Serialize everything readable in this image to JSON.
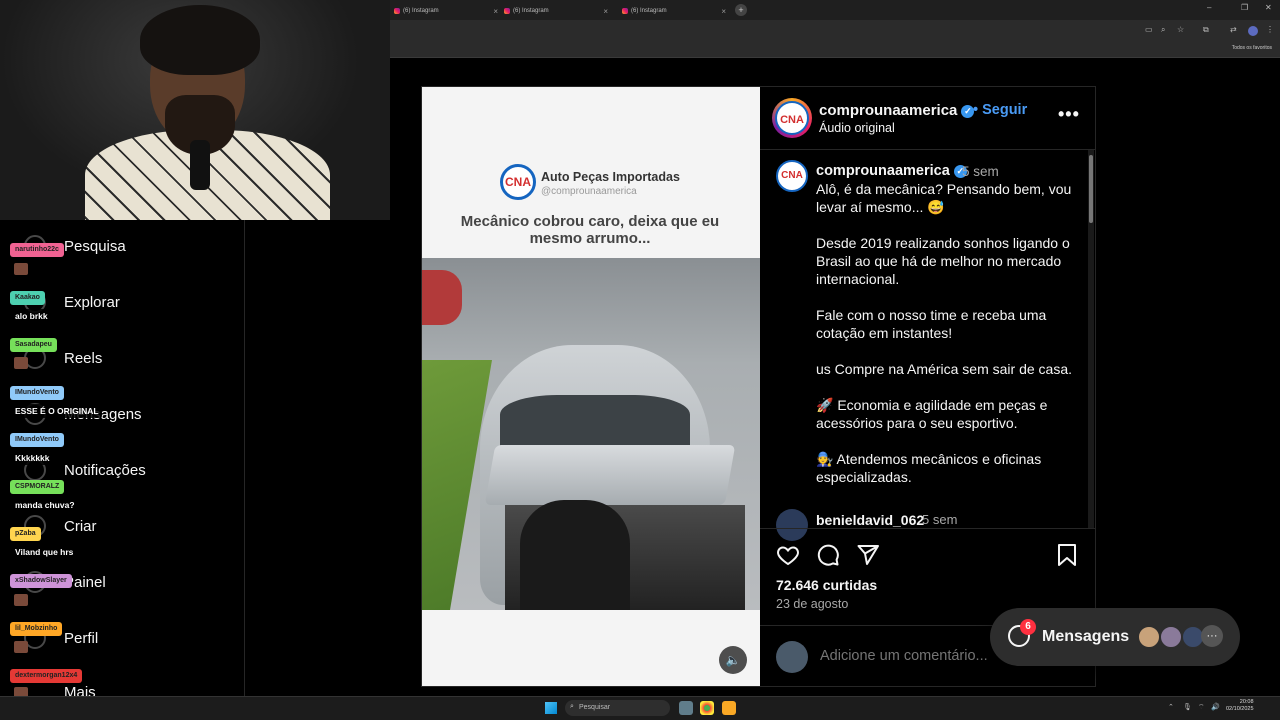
{
  "browser": {
    "tabs": [
      {
        "title": "(6) Instagram"
      },
      {
        "title": "(6) Instagram"
      },
      {
        "title": "(6) Instagram"
      }
    ],
    "bookmarks_folder": "Todos os favoritos"
  },
  "instagram_nav": {
    "items": [
      {
        "label": "Pesquisa",
        "icon": "search-icon"
      },
      {
        "label": "Explorar",
        "icon": "compass-icon"
      },
      {
        "label": "Reels",
        "icon": "reels-icon"
      },
      {
        "label": "Mensagens",
        "icon": "messenger-icon"
      },
      {
        "label": "Notificações",
        "icon": "heart-icon"
      },
      {
        "label": "Criar",
        "icon": "plus-icon"
      },
      {
        "label": "Painel",
        "icon": "dashboard-icon"
      },
      {
        "label": "Perfil",
        "icon": "profile-icon"
      },
      {
        "label": "Mais",
        "icon": "menu-icon"
      }
    ]
  },
  "chat": {
    "messages": [
      {
        "user": "narutinho22c",
        "text": "",
        "color": "#f06292"
      },
      {
        "user": "Kaakao",
        "text": "alo brkk",
        "color": "#4dd0b0"
      },
      {
        "user": "Sasadapeu",
        "text": "",
        "color": "#76e05a"
      },
      {
        "user": "IMundoVento",
        "text": "ESSE É O ORIGINAL",
        "color": "#90caf9"
      },
      {
        "user": "IMundoVento",
        "text": "Kkkkkkk",
        "color": "#90caf9"
      },
      {
        "user": "CSPMORALZ",
        "text": "manda chuva?",
        "color": "#76e05a"
      },
      {
        "user": "pZaba",
        "text": "Viland que hrs",
        "color": "#ffd54f"
      },
      {
        "user": "xShadowSlayer",
        "text": "",
        "color": "#ce93d8"
      },
      {
        "user": "lil_Mobzinho",
        "text": "",
        "color": "#ffa726"
      },
      {
        "user": "dextermorgan12x4",
        "text": "",
        "color": "#e53935"
      }
    ]
  },
  "post": {
    "video": {
      "brand": "Auto Peças Importadas",
      "handle": "@comprounaamerica",
      "caption": "Mecânico cobrou caro, deixa que eu mesmo arrumo...",
      "logo_text": "CNA"
    },
    "header": {
      "username": "comprounaamerica",
      "follow_label": "• Seguir",
      "audio": "Áudio original"
    },
    "caption": {
      "username": "comprounaamerica",
      "time": "5 sem",
      "text": "Alô, é da mecânica? Pensando bem, vou levar aí mesmo... 😅\n\nDesde 2019 realizando sonhos ligando o Brasil ao que há de melhor no mercado internacional.\n\nFale com o nosso time e receba uma cotação em instantes!\n\nus Compre na América sem sair de casa.\n\n🚀 Economia e agilidade em peças e acessórios para o seu esportivo.\n\n🧑‍🔧 Atendemos mecânicos e oficinas especializadas."
    },
    "first_comment": {
      "username": "benieldavid_062",
      "time": "5 sem"
    },
    "likes": "72.646 curtidas",
    "date": "23 de agosto",
    "comment_placeholder": "Adicione um comentário..."
  },
  "messages_pill": {
    "label": "Mensagens",
    "badge": "6"
  },
  "taskbar": {
    "search_placeholder": "Pesquisar",
    "time": "20:08",
    "date": "02/10/2025"
  },
  "colors": {
    "accent": "#4a9bf5",
    "badge": "#ff3040",
    "verified": "#3897f0"
  }
}
